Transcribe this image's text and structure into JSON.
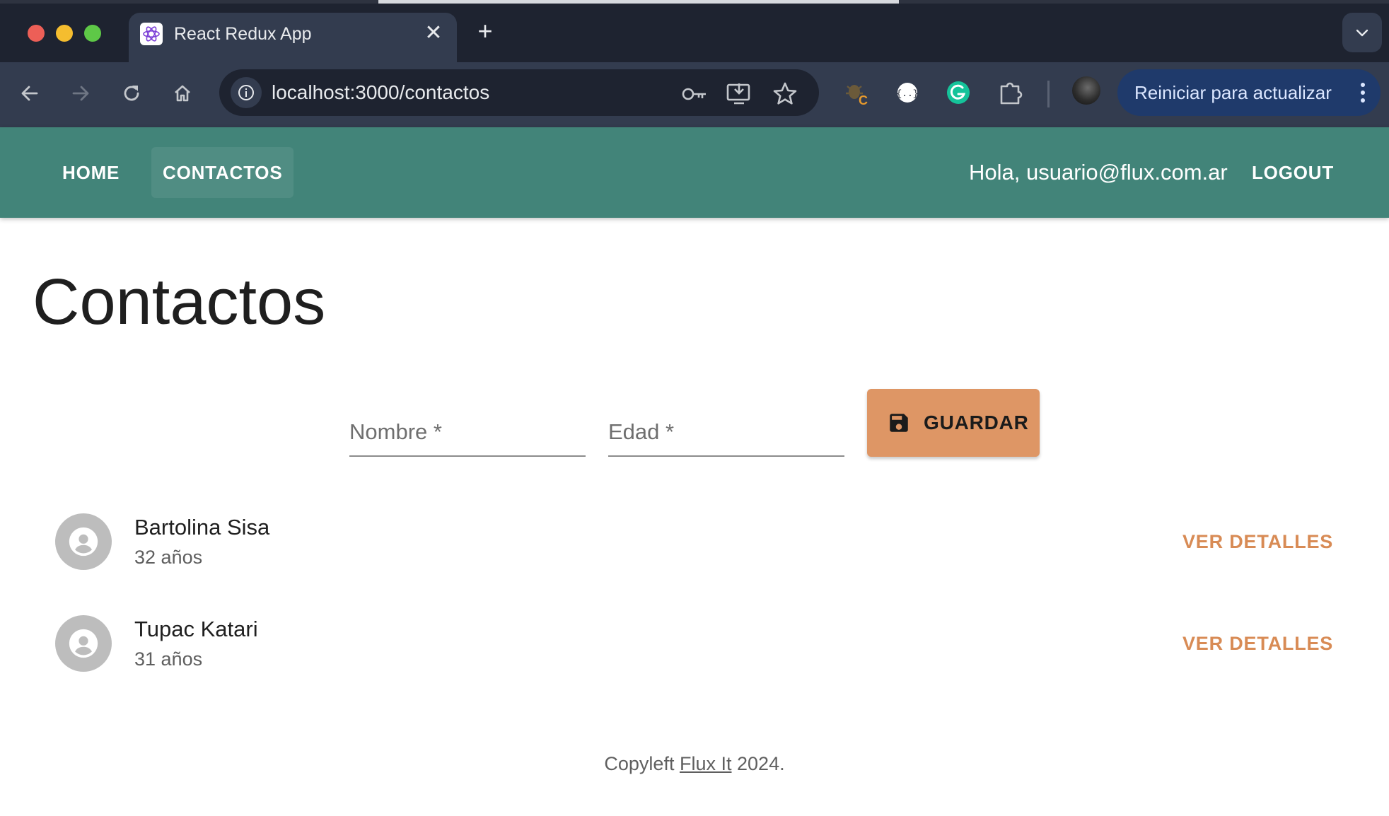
{
  "browser": {
    "tab_title": "React Redux App",
    "close_glyph": "✕",
    "new_tab_glyph": "+",
    "url": "localhost:3000/contactos",
    "update_button": "Reiniciar para actualizar"
  },
  "appbar": {
    "nav": [
      {
        "label": "HOME"
      },
      {
        "label": "CONTACTOS"
      }
    ],
    "greeting": "Hola, usuario@flux.com.ar",
    "logout": "LOGOUT",
    "color": "#428479"
  },
  "page": {
    "title": "Contactos"
  },
  "form": {
    "nombre_placeholder": "Nombre *",
    "edad_placeholder": "Edad *",
    "save_label": "GUARDAR",
    "save_icon": "save-icon",
    "button_color": "#de9665"
  },
  "contacts": [
    {
      "name": "Bartolina Sisa",
      "age": "32 años",
      "action": "VER DETALLES"
    },
    {
      "name": "Tupac Katari",
      "age": "31 años",
      "action": "VER DETALLES"
    }
  ],
  "footer": {
    "prefix": "Copyleft",
    "link": "Flux It",
    "suffix": "2024."
  }
}
